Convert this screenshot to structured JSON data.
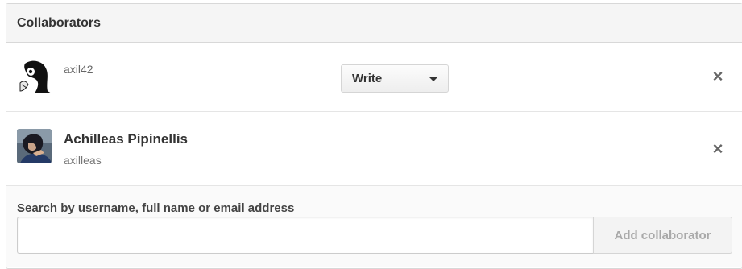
{
  "header": {
    "title": "Collaborators"
  },
  "collaborators": [
    {
      "username": "axil42",
      "permission": "Write",
      "remove_icon": "close-icon"
    },
    {
      "full_name": "Achilleas Pipinellis",
      "username": "axilleas",
      "remove_icon": "close-icon"
    }
  ],
  "add": {
    "search_label": "Search by username, full name or email address",
    "search_value": "",
    "search_placeholder": "",
    "button_label": "Add collaborator"
  },
  "icons": {
    "remove": "×",
    "caret": "caret-down-icon"
  },
  "colors": {
    "header_bg": "#f5f5f5",
    "border": "#d8d8d8",
    "disabled_text": "#a9a9a9"
  }
}
